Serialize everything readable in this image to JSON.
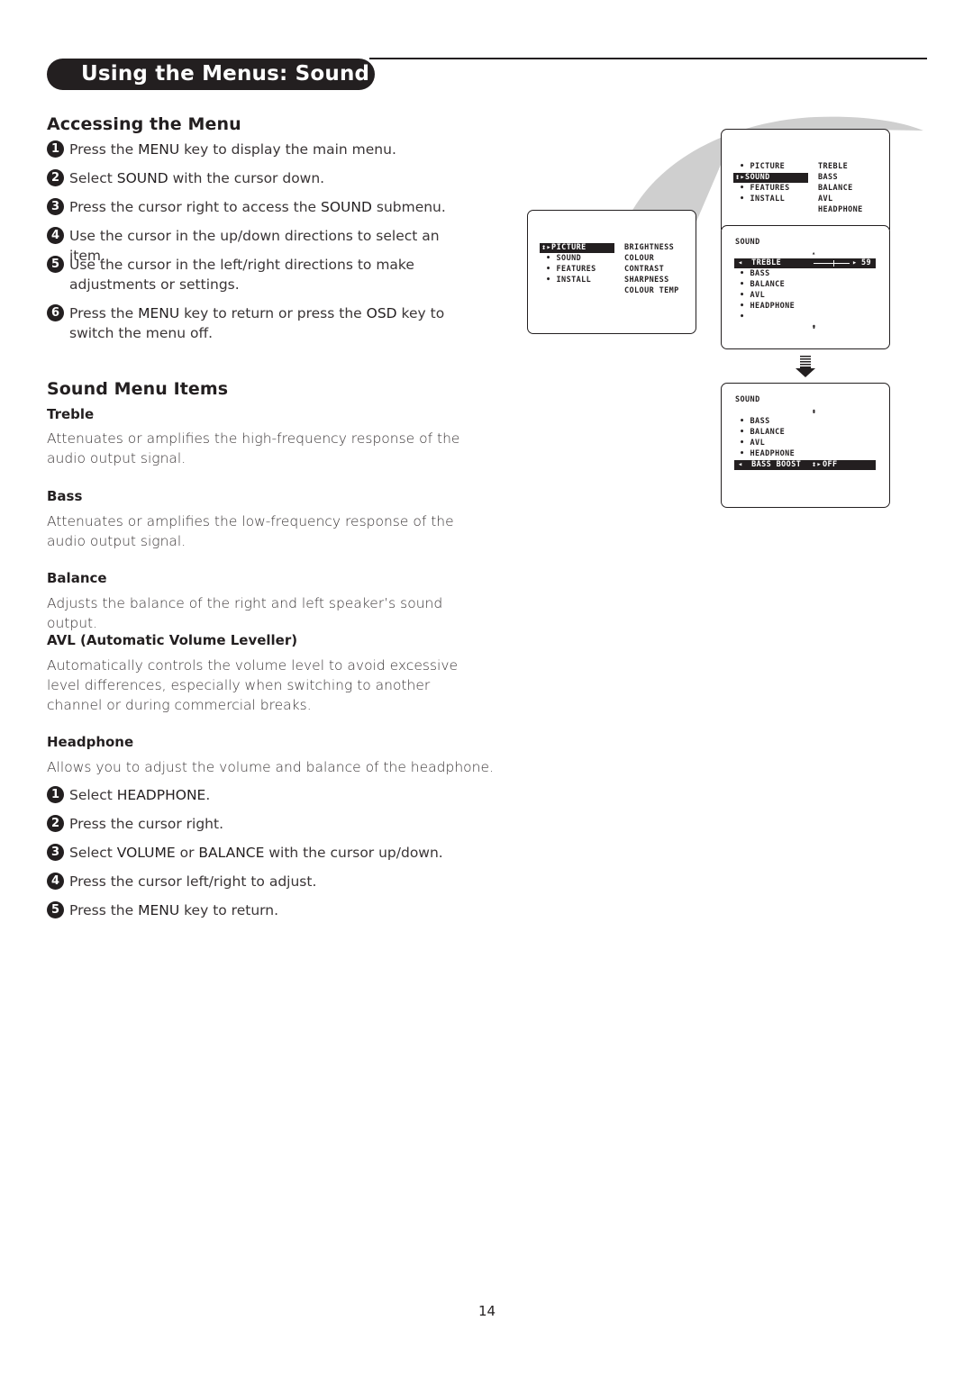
{
  "page": {
    "title": "Using the Menus: Sound",
    "page_number": "14"
  },
  "accessing": {
    "heading": "Accessing the Menu",
    "steps": [
      {
        "n": "1",
        "pre": "Press the ",
        "bold": "MENU",
        "post": " key to display the main menu."
      },
      {
        "n": "2",
        "pre": "Select ",
        "bold": "SOUND",
        "post": " with the cursor down."
      },
      {
        "n": "3",
        "pre": "Press the cursor right to access the ",
        "bold": "SOUND",
        "post": " submenu."
      },
      {
        "n": "4",
        "pre": "Use the cursor in the up/down directions to select an item.",
        "bold": "",
        "post": ""
      },
      {
        "n": "5",
        "pre": "Use the cursor in the left/right directions to make adjustments or settings.",
        "bold": "",
        "post": ""
      },
      {
        "n": "6",
        "pre": "Press the ",
        "bold": "MENU",
        "mid": " key to return or press the ",
        "bold2": "OSD",
        "post": " key to switch the menu off."
      }
    ]
  },
  "items": {
    "heading": "Sound Menu Items",
    "treble": {
      "title": "Treble",
      "desc": "Attenuates or amplifies the high-frequency response of the audio output signal."
    },
    "bass": {
      "title": "Bass",
      "desc": "Attenuates or amplifies the low-frequency response of the audio output signal."
    },
    "balance": {
      "title": "Balance",
      "desc": "Adjusts the balance of the right and left speaker’s sound output."
    },
    "avl": {
      "title": "AVL (Automatic Volume Leveller)",
      "desc": "Automatically controls the volume level to avoid excessive level differences, especially when switching to another channel or during commercial breaks."
    },
    "headphone": {
      "title": "Headphone",
      "desc": "Allows you to adjust the volume and balance of the headphone.",
      "steps": [
        {
          "n": "1",
          "pre": "Select ",
          "bold": "HEADPHONE",
          "post": "."
        },
        {
          "n": "2",
          "pre": "Press the cursor right.",
          "bold": "",
          "post": ""
        },
        {
          "n": "3",
          "pre": "Select ",
          "bold": "VOLUME",
          "mid": " or ",
          "bold2": "BALANCE",
          "post": " with the cursor up/down."
        },
        {
          "n": "4",
          "pre": "Press the cursor left/right to adjust.",
          "bold": "",
          "post": ""
        },
        {
          "n": "5",
          "pre": "Press the ",
          "bold": "MENU",
          "post": " key to return."
        }
      ]
    }
  },
  "screens": {
    "main_menu": {
      "left": [
        "PICTURE",
        "SOUND",
        "FEATURES",
        "INSTALL"
      ],
      "selected": "PICTURE",
      "right": [
        "BRIGHTNESS",
        "COLOUR",
        "CONTRAST",
        "SHARPNESS",
        "COLOUR TEMP"
      ]
    },
    "sound_select": {
      "left": [
        "PICTURE",
        "SOUND",
        "FEATURES",
        "INSTALL"
      ],
      "selected": "SOUND",
      "right": [
        "TREBLE",
        "BASS",
        "BALANCE",
        "AVL",
        "HEADPHONE"
      ]
    },
    "sound_submenu": {
      "title": "SOUND",
      "selected": "TREBLE",
      "value": "59",
      "slider_fraction": 0.55,
      "items": [
        "BASS",
        "BALANCE",
        "AVL",
        "HEADPHONE",
        ""
      ]
    },
    "sound_submenu_2": {
      "title": "SOUND",
      "items": [
        "BASS",
        "BALANCE",
        "AVL",
        "HEADPHONE"
      ],
      "selected": "BASS BOOST",
      "value": "OFF"
    }
  },
  "colors": {
    "ink": "#231f20",
    "text": "#3a3536",
    "swoosh": "#cfcfcf"
  }
}
